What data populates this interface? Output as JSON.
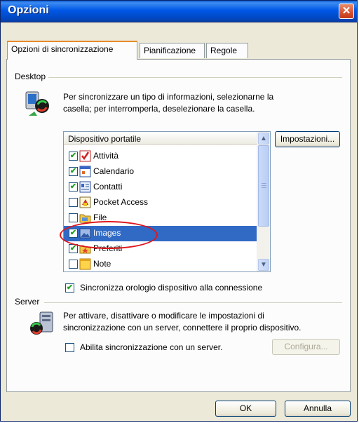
{
  "window": {
    "title": "Opzioni"
  },
  "tabs": [
    {
      "label": "Opzioni di sincronizzazione"
    },
    {
      "label": "Pianificazione"
    },
    {
      "label": "Regole"
    }
  ],
  "desktop": {
    "group_label": "Desktop",
    "description_line1": "Per sincronizzare un tipo di informazioni, selezionarne la",
    "description_line2": "casella; per interromperla, deselezionare la casella.",
    "list_header": "Dispositivo portatile",
    "settings_button": "Impostazioni...",
    "items": [
      {
        "label": "Attività",
        "checked": true,
        "icon": "tasks-icon"
      },
      {
        "label": "Calendario",
        "checked": true,
        "icon": "calendar-icon"
      },
      {
        "label": "Contatti",
        "checked": true,
        "icon": "contacts-icon"
      },
      {
        "label": "Pocket Access",
        "checked": false,
        "icon": "pocket-access-icon"
      },
      {
        "label": "File",
        "checked": false,
        "icon": "files-icon"
      },
      {
        "label": "Images",
        "checked": true,
        "icon": "images-icon",
        "selected": true
      },
      {
        "label": "Preferiti",
        "checked": true,
        "icon": "favorites-icon"
      },
      {
        "label": "Note",
        "checked": false,
        "icon": "notes-icon"
      }
    ],
    "clock_sync_label": "Sincronizza orologio dispositivo alla connessione",
    "clock_sync_checked": true
  },
  "server": {
    "group_label": "Server",
    "description_line1": "Per attivare, disattivare o modificare le impostazioni di",
    "description_line2": "sincronizzazione con un server, connettere il proprio dispositivo.",
    "enable_label": "Abilita sincronizzazione con un server.",
    "enable_checked": false,
    "configure_button": "Configura..."
  },
  "footer": {
    "ok_button": "OK",
    "cancel_button": "Annulla"
  },
  "colors": {
    "title_bar": "#0058e6",
    "selection": "#316ac5",
    "annotation": "#e0161c",
    "active_tab": "#e68b2c"
  }
}
